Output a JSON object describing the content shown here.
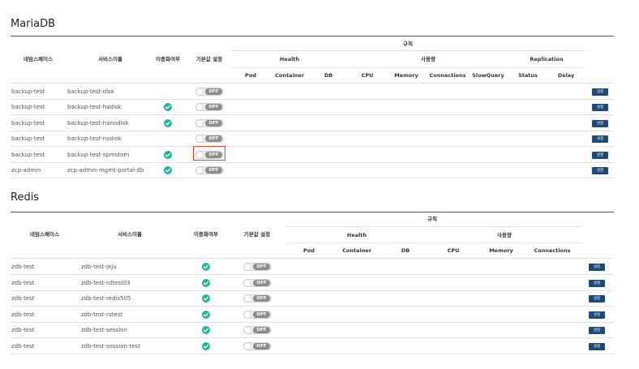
{
  "mariadb": {
    "title": "MariaDB",
    "columns": {
      "namespace": "네임스페이스",
      "service_name": "서비스이름",
      "redundancy": "이중화여부",
      "default_setting": "기본값 설정",
      "rules": "규칙",
      "health": "Health",
      "usage": "사용량",
      "replication": "Replication",
      "sub": [
        "Pod",
        "Container",
        "DB",
        "CPU",
        "Memory",
        "Connections",
        "SlowQuery",
        "Status",
        "Delay"
      ]
    },
    "rows": [
      {
        "namespace": "backup-test",
        "service": "backup-test-disk",
        "redundant": false,
        "toggle": "OFF",
        "action": "설정"
      },
      {
        "namespace": "backup-test",
        "service": "backup-test-hadisk",
        "redundant": true,
        "toggle": "OFF",
        "action": "설정"
      },
      {
        "namespace": "backup-test",
        "service": "backup-test-hanodisk",
        "redundant": true,
        "toggle": "OFF",
        "action": "설정"
      },
      {
        "namespace": "backup-test",
        "service": "backup-test-nodisk",
        "redundant": false,
        "toggle": "OFF",
        "action": "설정"
      },
      {
        "namespace": "backup-test",
        "service": "backup-test-spmstom",
        "redundant": true,
        "toggle": "OFF",
        "action": "설정"
      },
      {
        "namespace": "zcp-admin",
        "service": "zcp-admin-mgmt-portal-db",
        "redundant": true,
        "toggle": "OFF",
        "action": "설정"
      }
    ]
  },
  "redis": {
    "title": "Redis",
    "columns": {
      "namespace": "네임스페이스",
      "service_name": "서비스이름",
      "redundancy": "이중화여부",
      "default_setting": "기본값 설정",
      "rules": "규칙",
      "health": "Health",
      "usage": "사용량",
      "sub": [
        "Pod",
        "Container",
        "DB",
        "CPU",
        "Memory",
        "Connections"
      ]
    },
    "rows": [
      {
        "namespace": "zdb-test",
        "service": "zdb-test-jeju",
        "redundant": true,
        "toggle": "OFF",
        "action": "설정"
      },
      {
        "namespace": "zdb-test",
        "service": "zdb-test-rdtest03",
        "redundant": true,
        "toggle": "OFF",
        "action": "설정"
      },
      {
        "namespace": "zdb-test",
        "service": "zdb-test-redis505",
        "redundant": true,
        "toggle": "OFF",
        "action": "설정"
      },
      {
        "namespace": "zdb-test",
        "service": "zdb-test-rstest",
        "redundant": true,
        "toggle": "OFF",
        "action": "설정"
      },
      {
        "namespace": "zdb-test",
        "service": "zdb-test-session",
        "redundant": true,
        "toggle": "OFF",
        "action": "설정"
      },
      {
        "namespace": "zdb-test",
        "service": "zdb-test-session-test",
        "redundant": true,
        "toggle": "OFF",
        "action": "설정"
      }
    ]
  },
  "colors": {
    "check": "#26b49a",
    "button": "#1e4a78",
    "toggle_label": "#8d8d8d",
    "highlight": "#e8432e"
  },
  "icons": {
    "redundant": "check-circle-icon"
  }
}
